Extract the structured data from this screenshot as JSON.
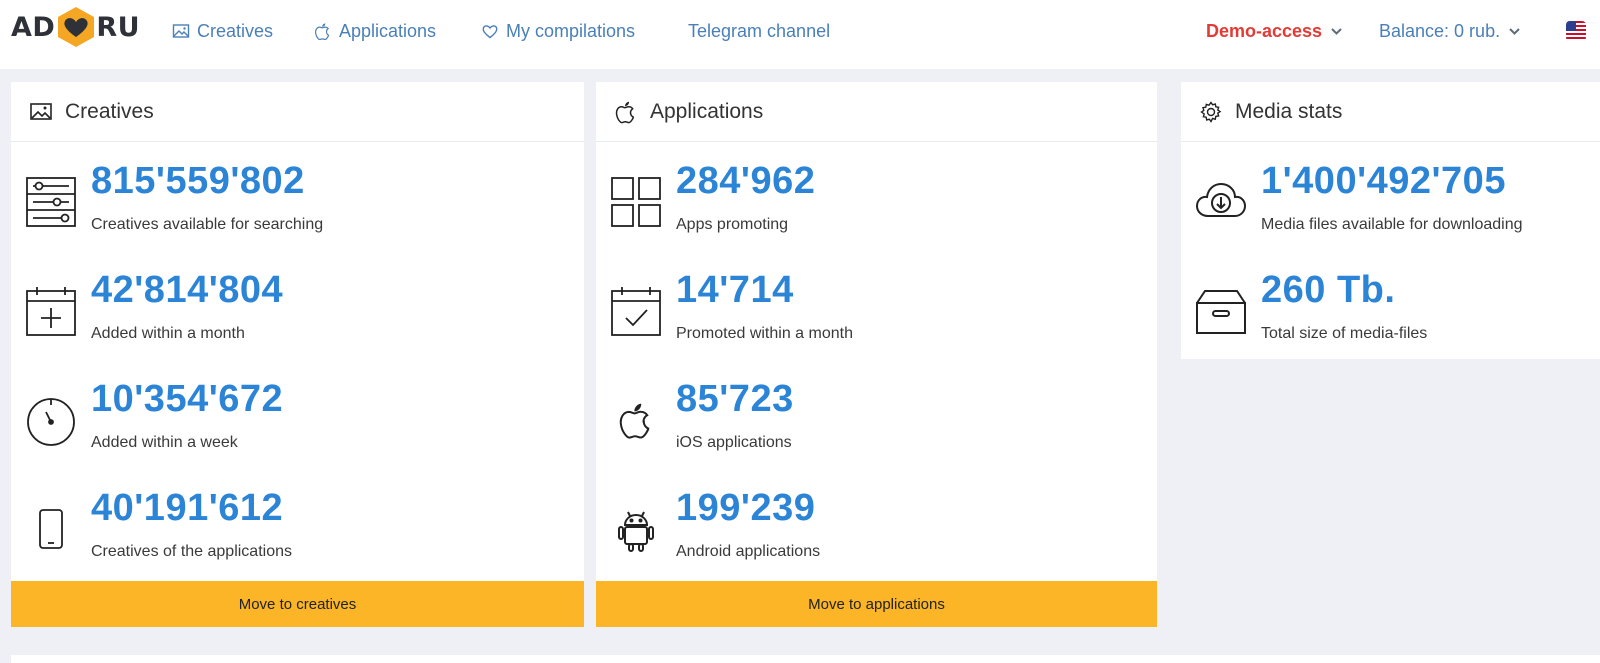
{
  "header": {
    "logo_left": "AD",
    "logo_right": "RU",
    "nav": [
      {
        "label": "Creatives",
        "icon": "image-icon"
      },
      {
        "label": "Applications",
        "icon": "apple-icon"
      },
      {
        "label": "My compilations",
        "icon": "heart-icon"
      },
      {
        "label": "Telegram channel",
        "icon": ""
      }
    ],
    "demo_access": "Demo-access",
    "balance": "Balance: 0 rub.",
    "language_flag": "us-flag-icon"
  },
  "cards": {
    "creatives": {
      "title": "Creatives",
      "stats": [
        {
          "value": "815'559'802",
          "label": "Creatives available for searching",
          "icon": "filter-sliders-icon"
        },
        {
          "value": "42'814'804",
          "label": "Added within a month",
          "icon": "calendar-plus-icon"
        },
        {
          "value": "10'354'672",
          "label": "Added within a week",
          "icon": "stopwatch-icon"
        },
        {
          "value": "40'191'612",
          "label": "Creatives of the applications",
          "icon": "smartphone-icon"
        }
      ],
      "button": "Move to creatives"
    },
    "applications": {
      "title": "Applications",
      "stats": [
        {
          "value": "284'962",
          "label": "Apps promoting",
          "icon": "grid-icon"
        },
        {
          "value": "14'714",
          "label": "Promoted within a month",
          "icon": "calendar-check-icon"
        },
        {
          "value": "85'723",
          "label": "iOS applications",
          "icon": "apple-icon"
        },
        {
          "value": "199'239",
          "label": "Android applications",
          "icon": "android-icon"
        }
      ],
      "button": "Move to applications"
    },
    "media": {
      "title": "Media stats",
      "stats": [
        {
          "value": "1'400'492'705",
          "label": "Media files available for downloading",
          "icon": "cloud-download-icon"
        },
        {
          "value": "260 Tb.",
          "label": "Total size of media-files",
          "icon": "archive-box-icon"
        }
      ]
    }
  },
  "colors": {
    "accent_blue": "#2b84d6",
    "nav_blue": "#4a7fb8",
    "demo_red": "#e23b36",
    "button_yellow": "#fbb526",
    "logo_orange": "#f5a623"
  }
}
